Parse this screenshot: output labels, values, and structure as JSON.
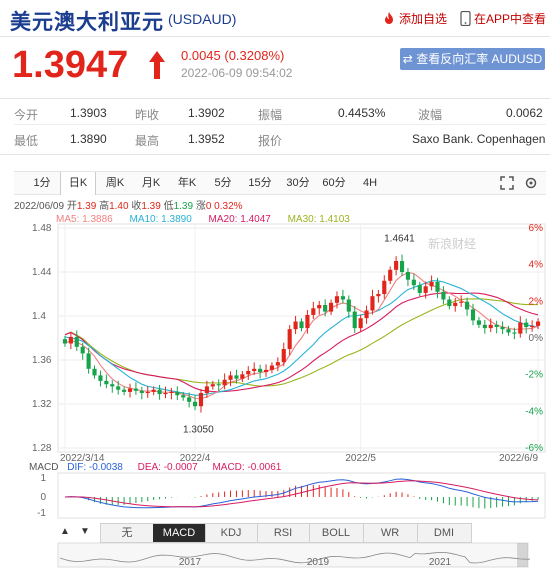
{
  "header": {
    "title": "美元澳大利亚元",
    "code": "(USDAUD)",
    "fav_label": "添加自选",
    "app_label": "在APP中查看"
  },
  "quote": {
    "price": "1.3947",
    "change": "0.0045 (0.3208%)",
    "time": "2022-06-09 09:54:02",
    "reverse_button": "查看反向汇率 AUDUSD",
    "rows": [
      [
        {
          "label": "今开",
          "value": "1.3903"
        },
        {
          "label": "昨收",
          "value": "1.3902"
        },
        {
          "label": "振幅",
          "value": "0.4453%"
        },
        {
          "label": "波幅",
          "value": "0.0062"
        }
      ],
      [
        {
          "label": "最低",
          "value": "1.3890"
        },
        {
          "label": "最高",
          "value": "1.3952"
        },
        {
          "label": "报价",
          "value": "Saxo Bank. Copenhagen"
        }
      ]
    ]
  },
  "tabs": [
    "1分",
    "日K",
    "周K",
    "月K",
    "年K",
    "5分",
    "15分",
    "30分",
    "60分",
    "4H"
  ],
  "active_tab": "日K",
  "info_line": {
    "date": "2022/06/09",
    "open_label": "开",
    "open": "1.39",
    "high_label": "高",
    "high": "1.40",
    "close_label": "收",
    "close": "1.39",
    "low_label": "低",
    "low": "1.39",
    "change_label": "涨",
    "change": "0 0.32%"
  },
  "ma_line": {
    "ma5": "MA5: 1.3886",
    "ma10": "MA10: 1.3890",
    "ma20": "MA20: 1.4047",
    "ma30": "MA30: 1.4103"
  },
  "macd_line": {
    "name": "MACD",
    "dif": "DIF: -0.0038",
    "dea": "DEA: -0.0007",
    "macd": "MACD: -0.0061"
  },
  "colors": {
    "up": "#e1251b",
    "down": "#16a34a",
    "ma5": "#f08080",
    "ma10": "#27b2d6",
    "ma20": "#d81b60",
    "ma30": "#9ab51e"
  },
  "chart_data": {
    "type": "candlestick",
    "y_ticks": [
      "1.48",
      "1.44",
      "1.4",
      "1.36",
      "1.32",
      "1.28"
    ],
    "pct_ticks": [
      "6%",
      "4%",
      "2%",
      "0%",
      "-2%",
      "-4%",
      "-6%"
    ],
    "x_ticks": [
      "2022/3/14",
      "2022/4",
      "2022/5",
      "2022/6/9"
    ],
    "ylim": [
      1.28,
      1.48
    ],
    "annotations": [
      {
        "label": "1.4641"
      },
      {
        "label": "1.3050"
      }
    ],
    "watermark": "新浪财经",
    "macd_ticks": [
      "1",
      "0",
      "-1"
    ],
    "indicator_tabs": [
      "无",
      "MACD",
      "KDJ",
      "RSI",
      "BOLL",
      "WR",
      "DMI"
    ],
    "active_indicator": "MACD",
    "nav_years": [
      "2017",
      "2019",
      "2021"
    ],
    "closes": [
      1.375,
      1.381,
      1.372,
      1.366,
      1.352,
      1.346,
      1.341,
      1.338,
      1.336,
      1.333,
      1.331,
      1.334,
      1.332,
      1.33,
      1.331,
      1.333,
      1.329,
      1.33,
      1.331,
      1.328,
      1.326,
      1.322,
      1.318,
      1.33,
      1.336,
      1.338,
      1.337,
      1.342,
      1.346,
      1.343,
      1.347,
      1.35,
      1.352,
      1.349,
      1.351,
      1.355,
      1.358,
      1.37,
      1.388,
      1.395,
      1.389,
      1.401,
      1.407,
      1.41,
      1.404,
      1.412,
      1.418,
      1.415,
      1.404,
      1.389,
      1.398,
      1.405,
      1.418,
      1.42,
      1.432,
      1.442,
      1.45,
      1.44,
      1.433,
      1.428,
      1.421,
      1.427,
      1.431,
      1.422,
      1.415,
      1.409,
      1.412,
      1.413,
      1.406,
      1.396,
      1.392,
      1.389,
      1.392,
      1.39,
      1.388,
      1.385,
      1.384,
      1.394,
      1.39,
      1.391,
      1.395
    ],
    "ma10": [
      1.381,
      1.38,
      1.379,
      1.377,
      1.373,
      1.369,
      1.364,
      1.36,
      1.356,
      1.352,
      1.348,
      1.344,
      1.341,
      1.338,
      1.336,
      1.335,
      1.334,
      1.333,
      1.332,
      1.331,
      1.33,
      1.329,
      1.328,
      1.328,
      1.329,
      1.33,
      1.331,
      1.332,
      1.333,
      1.335,
      1.337,
      1.339,
      1.341,
      1.342,
      1.343,
      1.345,
      1.347,
      1.35,
      1.354,
      1.359,
      1.364,
      1.369,
      1.374,
      1.38,
      1.385,
      1.389,
      1.393,
      1.397,
      1.4,
      1.4,
      1.401,
      1.402,
      1.403,
      1.405,
      1.408,
      1.411,
      1.415,
      1.42,
      1.424,
      1.426,
      1.428,
      1.43,
      1.432,
      1.432,
      1.431,
      1.429,
      1.427,
      1.425,
      1.422,
      1.419,
      1.416,
      1.413,
      1.41,
      1.406,
      1.402,
      1.399,
      1.396,
      1.394,
      1.392,
      1.391,
      1.39
    ]
  }
}
